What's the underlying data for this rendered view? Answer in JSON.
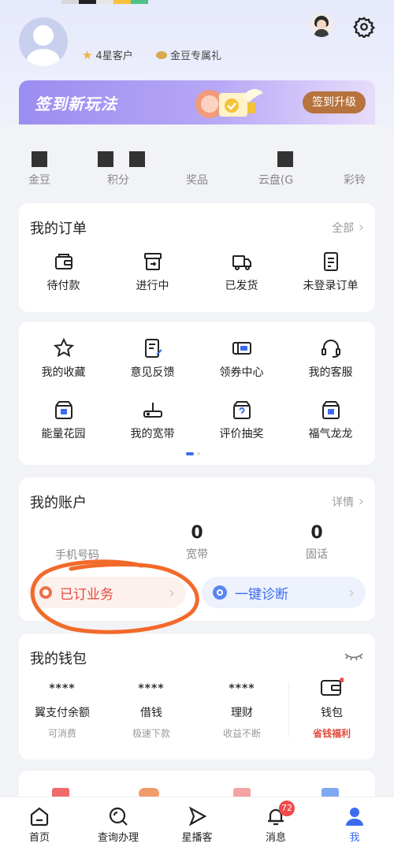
{
  "header": {
    "badges": [
      {
        "icon": "star-icon",
        "label": "4星客户"
      },
      {
        "icon": "gold-bean-icon",
        "label": "金豆专属礼"
      }
    ]
  },
  "banner": {
    "title": "签到新玩法",
    "button_label": "签到升级"
  },
  "stats": [
    {
      "label": "金豆"
    },
    {
      "label": "积分"
    },
    {
      "label": "奖品"
    },
    {
      "label": "云盘(G"
    },
    {
      "label": "彩铃"
    }
  ],
  "orders": {
    "title": "我的订单",
    "link": "全部",
    "items": [
      {
        "label": "待付款",
        "icon": "wallet-pay-icon"
      },
      {
        "label": "进行中",
        "icon": "box-progress-icon"
      },
      {
        "label": "已发货",
        "icon": "truck-icon"
      },
      {
        "label": "未登录订单",
        "icon": "document-icon"
      }
    ]
  },
  "services": {
    "row1": [
      {
        "label": "我的收藏",
        "icon": "star-outline-icon"
      },
      {
        "label": "意见反馈",
        "icon": "feedback-icon"
      },
      {
        "label": "领券中心",
        "icon": "coupon-icon"
      },
      {
        "label": "我的客服",
        "icon": "headset-icon"
      }
    ],
    "row2": [
      {
        "label": "能量花园",
        "icon": "fortune-box-icon"
      },
      {
        "label": "我的宽带",
        "icon": "router-icon"
      },
      {
        "label": "评价抽奖",
        "icon": "question-box-icon"
      },
      {
        "label": "福气龙龙",
        "icon": "fortune-box-icon"
      }
    ],
    "page_dots": {
      "count": 2,
      "active": 0
    }
  },
  "account": {
    "title": "我的账户",
    "link": "详情",
    "columns": [
      {
        "value": "",
        "label": "手机号码"
      },
      {
        "value": "0",
        "label": "宽带"
      },
      {
        "value": "0",
        "label": "固话"
      }
    ],
    "actions": [
      {
        "label": "已订业务",
        "icon": "coin-icon"
      },
      {
        "label": "一键诊断",
        "icon": "diagnose-icon"
      }
    ]
  },
  "wallet": {
    "title": "我的钱包",
    "items": [
      {
        "amount": "****",
        "name": "翼支付余额",
        "sub": "可消费"
      },
      {
        "amount": "****",
        "name": "借钱",
        "sub": "极速下款"
      },
      {
        "amount": "****",
        "name": "理财",
        "sub": "收益不断"
      }
    ],
    "wallet_entry": {
      "name": "钱包",
      "sub": "省钱福利"
    }
  },
  "tabbar": {
    "tabs": [
      {
        "label": "首页",
        "icon": "home-icon"
      },
      {
        "label": "查询办理",
        "icon": "search-handle-icon"
      },
      {
        "label": "星播客",
        "icon": "play-icon"
      },
      {
        "label": "消息",
        "icon": "bell-icon",
        "badge": "72"
      },
      {
        "label": "我",
        "icon": "profile-icon",
        "active": true
      }
    ]
  },
  "colors": {
    "accent": "#3b6cf0",
    "badge_red": "#f04a4a",
    "banner_button": "#b7733d",
    "annotation": "#f26a2a",
    "highlight_red": "#e24a3b"
  }
}
